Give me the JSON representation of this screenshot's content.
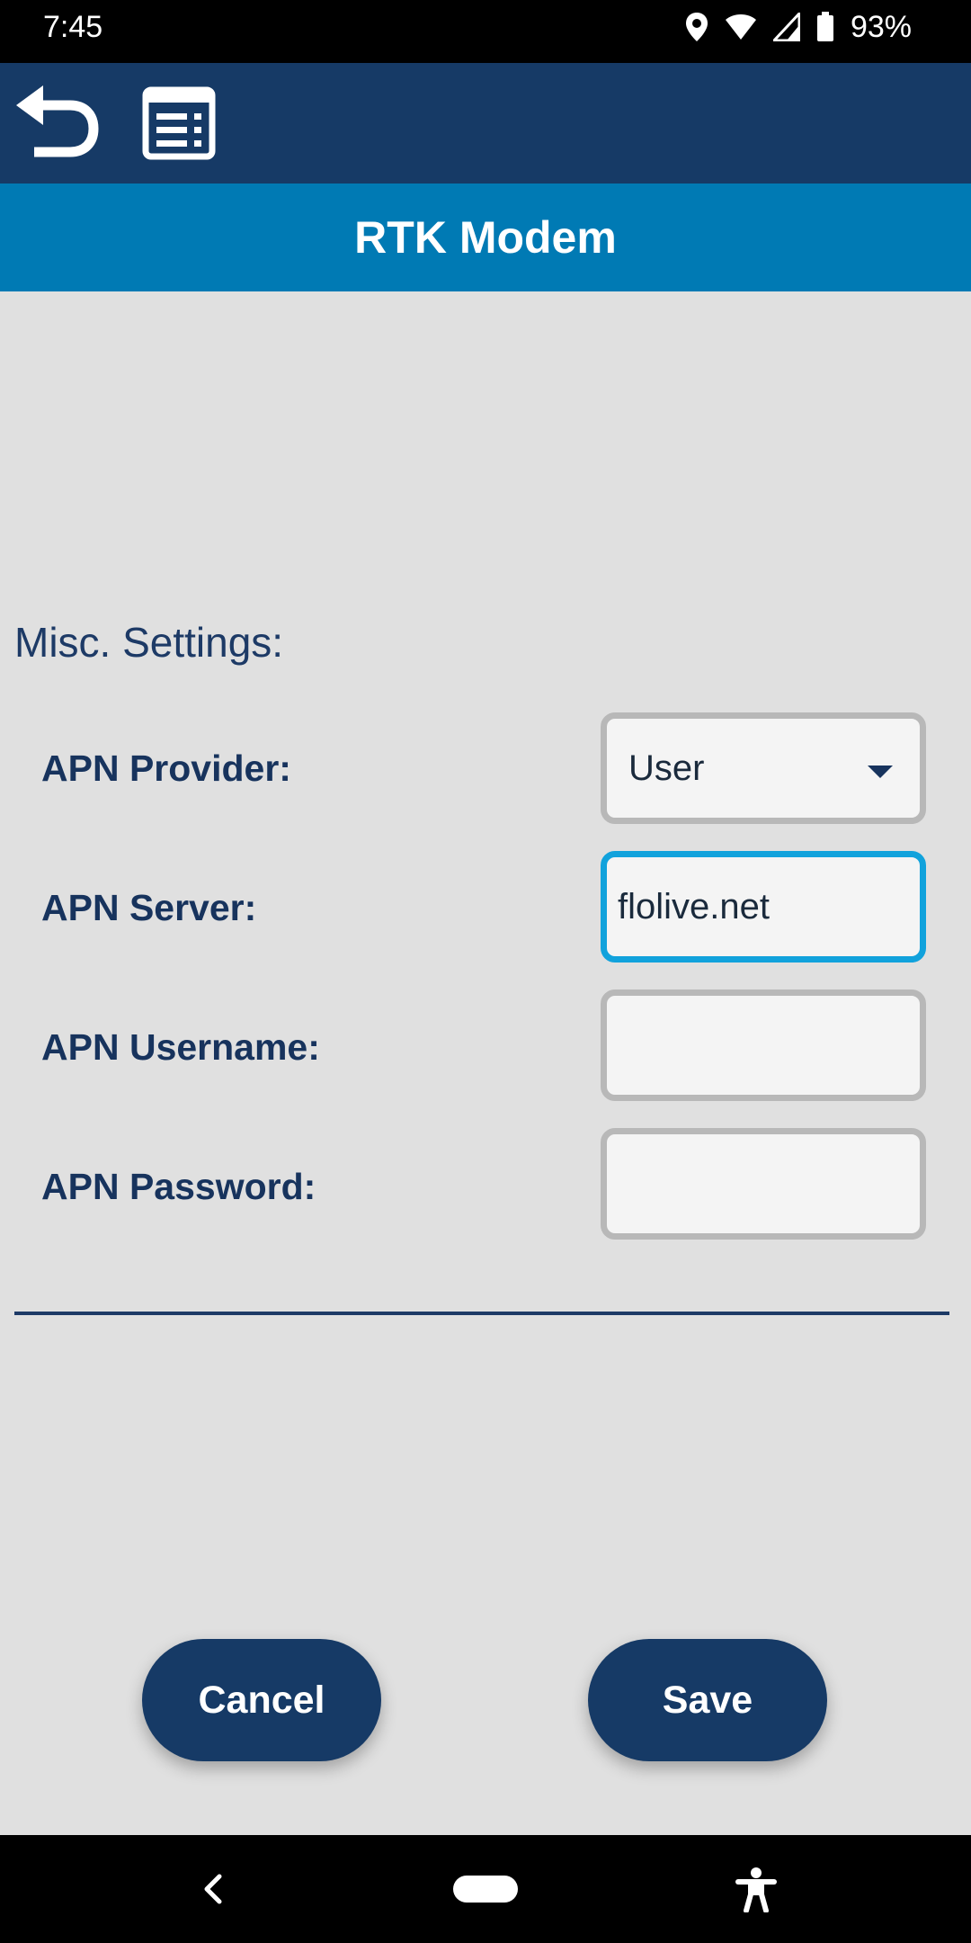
{
  "status_bar": {
    "time": "7:45",
    "battery_percent": "93%",
    "icons": [
      "location-icon",
      "wifi-icon",
      "signal-icon",
      "battery-icon"
    ]
  },
  "toolbar": {
    "back_icon": "undo-back-icon",
    "menu_icon": "settings-list-icon"
  },
  "header": {
    "title": "RTK Modem"
  },
  "section": {
    "heading": "Misc. Settings:"
  },
  "fields": {
    "apn_provider": {
      "label": "APN Provider:",
      "value": "User"
    },
    "apn_server": {
      "label": "APN Server:",
      "value": "flolive.net"
    },
    "apn_username": {
      "label": "APN Username:",
      "value": ""
    },
    "apn_password": {
      "label": "APN Password:",
      "value": ""
    }
  },
  "actions": {
    "cancel_label": "Cancel",
    "save_label": "Save"
  },
  "nav_bar": {
    "icons": [
      "nav-back-icon",
      "nav-home-pill",
      "accessibility-icon"
    ]
  },
  "colors": {
    "toolbar": "#163a66",
    "title_bar": "#007ab4",
    "background": "#e0e0e0",
    "focus_border": "#11a2dc",
    "label_text": "#17335d"
  }
}
